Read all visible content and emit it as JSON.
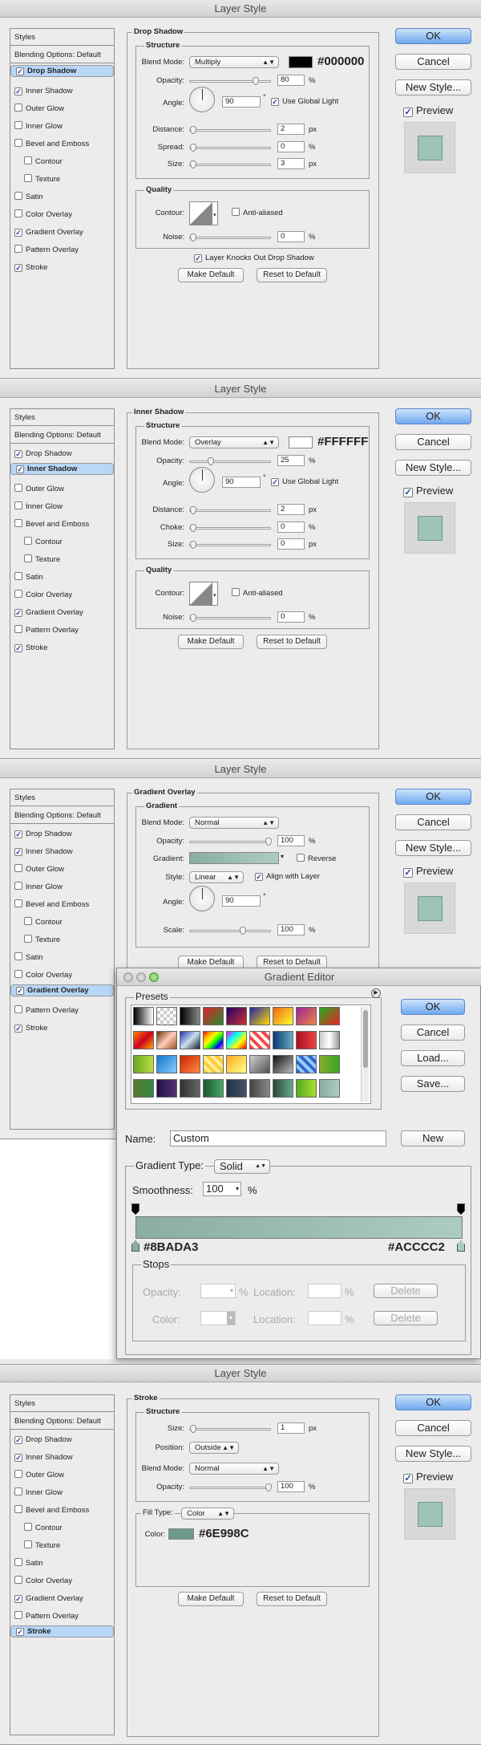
{
  "dialogs": {
    "drop_shadow": {
      "title": "Layer Style",
      "section_title": "Drop Shadow",
      "structure_title": "Structure",
      "blend_mode_label": "Blend Mode:",
      "blend_mode": "Multiply",
      "color_hex": "#000000",
      "opacity_label": "Opacity:",
      "opacity": "80",
      "angle_label": "Angle:",
      "angle": "90",
      "global_light": "Use Global Light",
      "distance_label": "Distance:",
      "distance": "2",
      "spread_label": "Spread:",
      "spread": "0",
      "size_label": "Size:",
      "size": "3",
      "quality_title": "Quality",
      "contour_label": "Contour:",
      "anti_aliased": "Anti-aliased",
      "noise_label": "Noise:",
      "noise": "0",
      "knocks_out": "Layer Knocks Out Drop Shadow",
      "make_default": "Make Default",
      "reset_default": "Reset to Default"
    },
    "inner_shadow": {
      "title": "Layer Style",
      "section_title": "Inner Shadow",
      "structure_title": "Structure",
      "blend_mode_label": "Blend Mode:",
      "blend_mode": "Overlay",
      "color_hex": "#FFFFFF",
      "opacity_label": "Opacity:",
      "opacity": "25",
      "angle_label": "Angle:",
      "angle": "90",
      "global_light": "Use Global Light",
      "distance_label": "Distance:",
      "distance": "2",
      "choke_label": "Choke:",
      "choke": "0",
      "size_label": "Size:",
      "size": "0",
      "quality_title": "Quality",
      "contour_label": "Contour:",
      "anti_aliased": "Anti-aliased",
      "noise_label": "Noise:",
      "noise": "0",
      "make_default": "Make Default",
      "reset_default": "Reset to Default"
    },
    "gradient_overlay": {
      "title": "Layer Style",
      "section_title": "Gradient Overlay",
      "group_title": "Gradient",
      "blend_mode_label": "Blend Mode:",
      "blend_mode": "Normal",
      "opacity_label": "Opacity:",
      "opacity": "100",
      "gradient_label": "Gradient:",
      "reverse": "Reverse",
      "style_label": "Style:",
      "style": "Linear",
      "align_layer": "Align with Layer",
      "angle_label": "Angle:",
      "angle": "90",
      "scale_label": "Scale:",
      "scale": "100",
      "make_default": "Make Default",
      "reset_default": "Reset to Default"
    },
    "stroke": {
      "title": "Layer Style",
      "section_title": "Stroke",
      "structure_title": "Structure",
      "size_label": "Size:",
      "size": "1",
      "position_label": "Position:",
      "position": "Outside",
      "blend_mode_label": "Blend Mode:",
      "blend_mode": "Normal",
      "opacity_label": "Opacity:",
      "opacity": "100",
      "fill_type_label": "Fill Type:",
      "fill_type": "Color",
      "color_label": "Color:",
      "color_hex": "#6E998C",
      "make_default": "Make Default",
      "reset_default": "Reset to Default"
    }
  },
  "sidebar": {
    "styles": "Styles",
    "blending": "Blending Options: Default",
    "items": [
      "Drop Shadow",
      "Inner Shadow",
      "Outer Glow",
      "Inner Glow",
      "Bevel and Emboss",
      "Contour",
      "Texture",
      "Satin",
      "Color Overlay",
      "Gradient Overlay",
      "Pattern Overlay",
      "Stroke"
    ],
    "checked": [
      true,
      true,
      false,
      false,
      false,
      false,
      false,
      false,
      false,
      true,
      false,
      true
    ]
  },
  "buttons": {
    "ok": "OK",
    "cancel": "Cancel",
    "new_style": "New Style...",
    "preview": "Preview"
  },
  "gradient_editor": {
    "title": "Gradient Editor",
    "presets_title": "Presets",
    "ok": "OK",
    "cancel": "Cancel",
    "load": "Load...",
    "save": "Save...",
    "name_label": "Name:",
    "name_value": "Custom",
    "new_button": "New",
    "gradient_type_label": "Gradient Type:",
    "gradient_type": "Solid",
    "smoothness_label": "Smoothness:",
    "smoothness": "100",
    "percent": "%",
    "stop_left_hex": "#8BADA3",
    "stop_right_hex": "#ACCCC2",
    "stops_title": "Stops",
    "opacity_label": "Opacity:",
    "location_label": "Location:",
    "color_label": "Color:",
    "delete": "Delete"
  },
  "units": {
    "px": "px",
    "percent": "%",
    "degree": "°"
  },
  "colors": {
    "shadow": "#000000",
    "highlight": "#FFFFFF",
    "grad_left": "#8BADA3",
    "grad_right": "#ACCCC2",
    "stroke": "#6E998C",
    "selection": "#B8D6F6"
  }
}
